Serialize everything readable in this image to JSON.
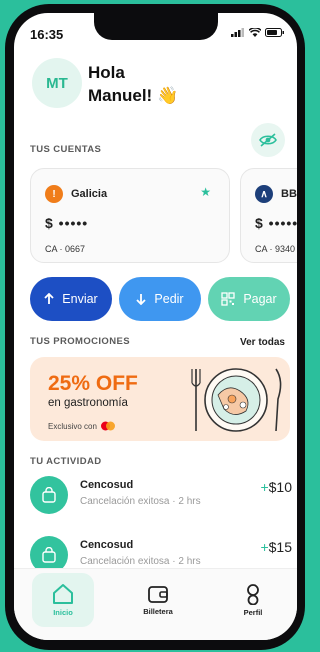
{
  "status_bar": {
    "time": "16:35"
  },
  "user": {
    "initials": "MT",
    "greeting_line1": "Hola",
    "greeting_line2": "Manuel! 👋"
  },
  "accounts": {
    "section_label": "TUS CUENTAS",
    "items": [
      {
        "bank": "Galicia",
        "balance": "$ •••••",
        "account": "CA · 0667",
        "favorite": true,
        "logo_color": "#f07d1a",
        "logo_glyph": "!"
      },
      {
        "bank": "BBVA",
        "balance": "$ •••••",
        "account": "CA · 9340",
        "favorite": false,
        "logo_color": "#1d3f7a",
        "logo_glyph": "∧"
      }
    ]
  },
  "actions": [
    {
      "label": "Enviar",
      "icon": "arrow-up-icon",
      "color": "#1d4fc4"
    },
    {
      "label": "Pedir",
      "icon": "arrow-down-icon",
      "color": "#3f97f0"
    },
    {
      "label": "Pagar",
      "icon": "qr-icon",
      "color": "#62d3b3"
    }
  ],
  "promotions": {
    "section_label": "TUS PROMOCIONES",
    "see_all": "Ver todas",
    "promo": {
      "headline": "25% OFF",
      "subtitle": "en gastronomía",
      "exclusive": "Exclusivo con"
    }
  },
  "activity": {
    "section_label": "TU ACTIVIDAD",
    "items": [
      {
        "merchant": "Cencosud",
        "detail": "Cancelación exitosa · 2 hrs",
        "amount_sign": "+",
        "amount": "$10"
      },
      {
        "merchant": "Cencosud",
        "detail": "Cancelación exitosa · 2 hrs",
        "amount_sign": "+",
        "amount": "$15"
      }
    ]
  },
  "tabbar": [
    {
      "label": "Inicio",
      "icon": "home-icon",
      "active": true
    },
    {
      "label": "Billetera",
      "icon": "wallet-icon",
      "active": false
    },
    {
      "label": "Perfil",
      "icon": "user-icon",
      "active": false
    }
  ],
  "colors": {
    "brand": "#2bbf9c",
    "promo_bg": "#fde9da",
    "promo_accent": "#ef6b12"
  }
}
